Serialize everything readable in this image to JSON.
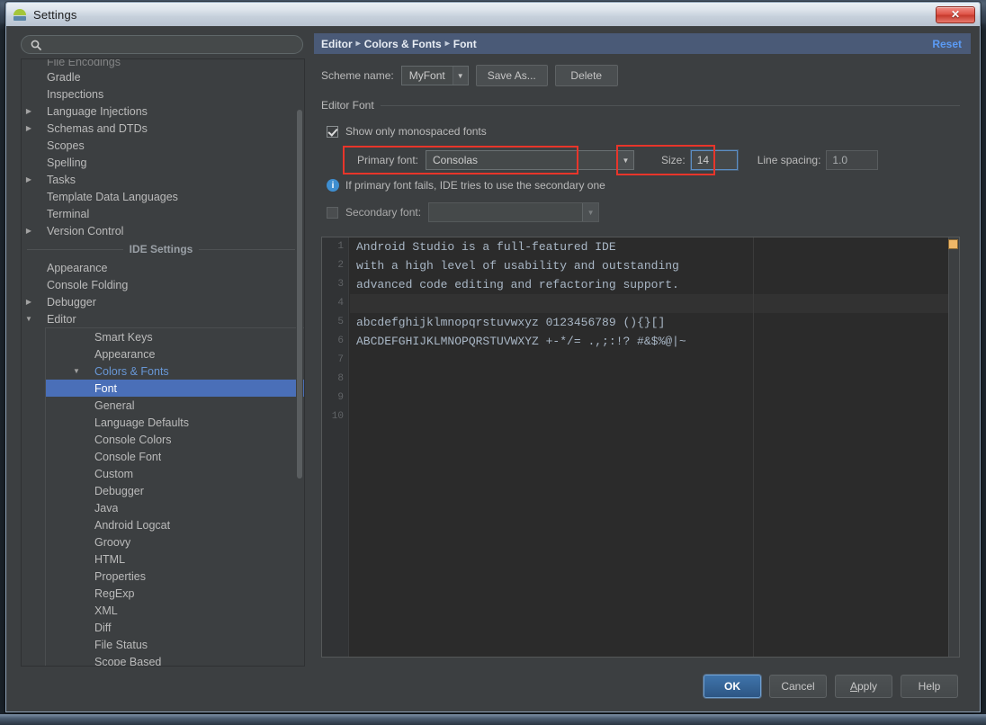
{
  "window": {
    "title": "Settings",
    "app_icon": "android-studio-icon",
    "close_label": "✕"
  },
  "search": {
    "value": "",
    "placeholder": "",
    "icon": "search-icon"
  },
  "tree": {
    "clipped_top_item": "File Encodings",
    "project_items": [
      {
        "label": "Gradle",
        "arrow": "",
        "indent": 0
      },
      {
        "label": "Inspections",
        "arrow": "",
        "indent": 0
      },
      {
        "label": "Language Injections",
        "arrow": "▶",
        "indent": 0
      },
      {
        "label": "Schemas and DTDs",
        "arrow": "▶",
        "indent": 0
      },
      {
        "label": "Scopes",
        "arrow": "",
        "indent": 0
      },
      {
        "label": "Spelling",
        "arrow": "",
        "indent": 0
      },
      {
        "label": "Tasks",
        "arrow": "▶",
        "indent": 0
      },
      {
        "label": "Template Data Languages",
        "arrow": "",
        "indent": 0
      },
      {
        "label": "Terminal",
        "arrow": "",
        "indent": 0
      },
      {
        "label": "Version Control",
        "arrow": "▶",
        "indent": 0
      }
    ],
    "section_label": "IDE Settings",
    "ide_items": [
      {
        "label": "Appearance",
        "arrow": "",
        "indent": 0
      },
      {
        "label": "Console Folding",
        "arrow": "",
        "indent": 0
      },
      {
        "label": "Debugger",
        "arrow": "▶",
        "indent": 0
      },
      {
        "label": "Editor",
        "arrow": "▼",
        "indent": 0
      }
    ],
    "editor_children": [
      {
        "label": "Smart Keys",
        "arrow": "",
        "indent": 2
      },
      {
        "label": "Appearance",
        "arrow": "",
        "indent": 2
      },
      {
        "label": "Colors & Fonts",
        "arrow": "▼",
        "indent": 2,
        "state": "expanded"
      }
    ],
    "colors_fonts_children": [
      {
        "label": "Font",
        "state": "selected"
      },
      {
        "label": "General",
        "state": ""
      },
      {
        "label": "Language Defaults",
        "state": ""
      },
      {
        "label": "Console Colors",
        "state": ""
      },
      {
        "label": "Console Font",
        "state": ""
      },
      {
        "label": "Custom",
        "state": ""
      },
      {
        "label": "Debugger",
        "state": ""
      },
      {
        "label": "Java",
        "state": ""
      },
      {
        "label": "Android Logcat",
        "state": ""
      },
      {
        "label": "Groovy",
        "state": ""
      },
      {
        "label": "HTML",
        "state": ""
      },
      {
        "label": "Properties",
        "state": ""
      },
      {
        "label": "RegExp",
        "state": ""
      },
      {
        "label": "XML",
        "state": ""
      },
      {
        "label": "Diff",
        "state": ""
      },
      {
        "label": "File Status",
        "state": ""
      },
      {
        "label": "Scope Based",
        "state": ""
      }
    ]
  },
  "breadcrumb": {
    "crumb1": "Editor",
    "crumb2": "Colors & Fonts",
    "crumb3": "Font",
    "separator": "▸",
    "reset_label": "Reset"
  },
  "scheme": {
    "label": "Scheme name:",
    "value": "MyFont",
    "dropdown_arrow": "▼",
    "save_as_label": "Save As...",
    "delete_label": "Delete"
  },
  "editor_font": {
    "group_title": "Editor Font",
    "monospaced_label": "Show only monospaced fonts",
    "monospaced_checked": true,
    "primary_font_label": "Primary font:",
    "primary_font_value": "Consolas",
    "size_label": "Size:",
    "size_value": "14",
    "line_spacing_label": "Line spacing:",
    "line_spacing_value": "1.0",
    "hint": "If primary font fails, IDE tries to use the secondary one",
    "hint_icon": "info-icon",
    "secondary_font_label": "Secondary font:",
    "secondary_font_value": "",
    "secondary_checked": false,
    "dropdown_arrow": "▼"
  },
  "preview": {
    "line_numbers": [
      "1",
      "2",
      "3",
      "4",
      "5",
      "6",
      "7",
      "8",
      "9",
      "10"
    ],
    "lines": [
      "Android Studio is a full-featured IDE",
      "with a high level of usability and outstanding",
      "advanced code editing and refactoring support.",
      "",
      "abcdefghijklmnopqrstuvwxyz 0123456789 (){}[]",
      "ABCDEFGHIJKLMNOPQRSTUVWXYZ +-*/= .,;:!? #&$%@|~",
      "",
      "",
      "",
      ""
    ],
    "caret_line_index": 3,
    "marker_color": "#f0b868"
  },
  "buttons": {
    "ok": "OK",
    "cancel": "Cancel",
    "apply_prefix": "A",
    "apply_rest": "pply",
    "help": "Help"
  },
  "colors": {
    "accent_selection": "#4a6fb8",
    "breadcrumb_bg": "#4a5a77",
    "link": "#5b9bf5",
    "annotation_red": "#e8352a",
    "dialog_bg": "#3c3f41",
    "editor_bg": "#2b2b2b"
  }
}
